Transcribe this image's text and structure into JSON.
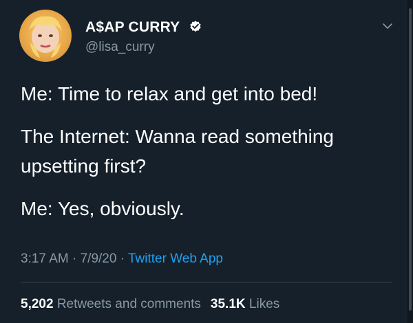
{
  "author": {
    "display_name": "A$AP CURRY",
    "handle": "@lisa_curry",
    "verified": true,
    "avatar_icon": "profile-photo"
  },
  "tweet": {
    "lines": [
      "Me: Time to relax and get into bed!",
      "The Internet: Wanna read something",
      "upsetting first?",
      "Me: Yes, obviously."
    ]
  },
  "meta": {
    "time": "3:17 AM",
    "separator": "·",
    "date": "7/9/20",
    "source": "Twitter Web App"
  },
  "stats": {
    "retweets_count": "5,202",
    "retweets_label": "Retweets and comments",
    "likes_count": "35.1K",
    "likes_label": "Likes"
  },
  "colors": {
    "background": "#15202b",
    "text": "#ffffff",
    "muted": "#8899a6",
    "accent": "#1da1f2",
    "divider": "#38444d"
  }
}
